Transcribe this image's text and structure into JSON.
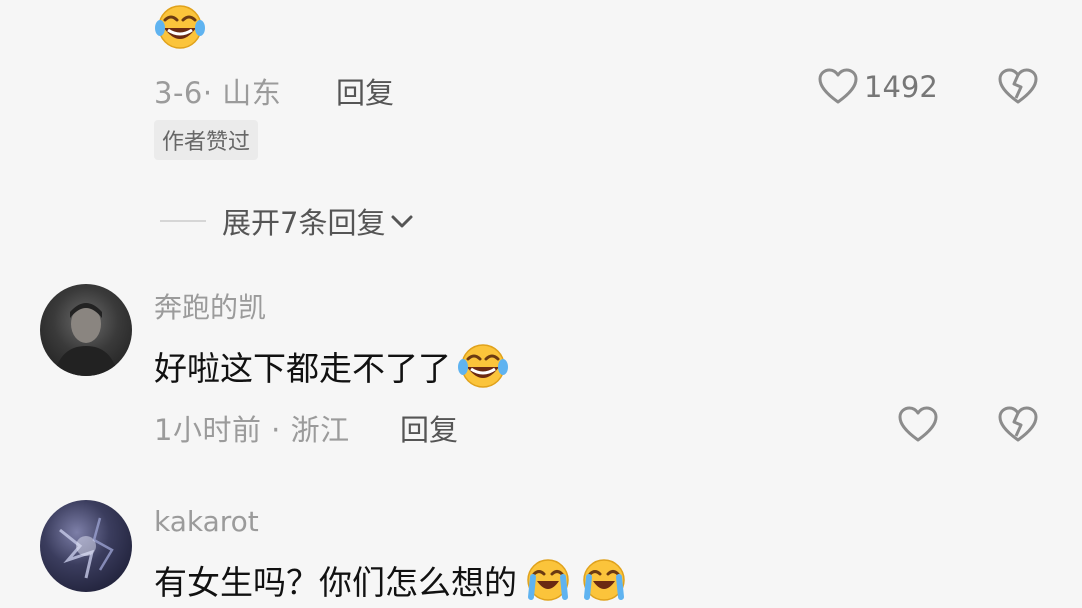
{
  "comments": [
    {
      "emoji": "face-with-tears-of-joy",
      "time_location": "3-6· 山东",
      "reply_label": "回复",
      "like_count": "1492",
      "badge": "作者赞过",
      "expand_label": "展开7条回复"
    },
    {
      "username": "奔跑的凯",
      "text": "好啦这下都走不了了",
      "emoji": "face-with-tears-of-joy",
      "time_location": "1小时前 · 浙江",
      "reply_label": "回复"
    },
    {
      "username": "kakarot",
      "text": "有女生吗？你们怎么想的",
      "emojis": [
        "loudly-crying-face",
        "loudly-crying-face"
      ]
    }
  ],
  "colors": {
    "background": "#f6f6f6",
    "meta_text": "#9b9b9b",
    "icon_stroke": "#8c8c8c",
    "emoji_yellow": "#fbc43b"
  }
}
